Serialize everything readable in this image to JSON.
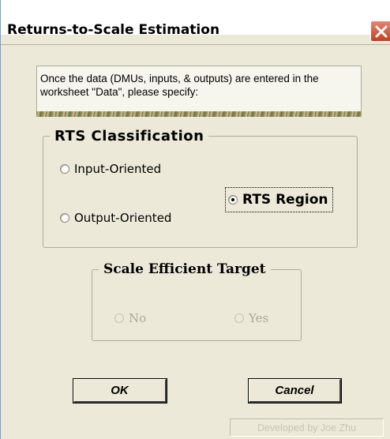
{
  "window": {
    "title": "Returns-to-Scale Estimation",
    "close_icon": "close-x-icon"
  },
  "info": {
    "text": "Once the data (DMUs, inputs, & outputs) are entered in the worksheet \"Data\", please specify:"
  },
  "rts_classification": {
    "title": "RTS Classification",
    "options": [
      {
        "label": "Input-Oriented",
        "selected": false
      },
      {
        "label": "Output-Oriented",
        "selected": false
      },
      {
        "label": "RTS Region",
        "selected": true
      }
    ]
  },
  "scale_efficient_target": {
    "title": "Scale Efficient Target",
    "enabled": false,
    "options": [
      {
        "label": "No",
        "selected": false
      },
      {
        "label": "Yes",
        "selected": false
      }
    ]
  },
  "buttons": {
    "ok": "OK",
    "cancel": "Cancel"
  },
  "footer": {
    "credit": "Developed by Joe Zhu"
  },
  "colors": {
    "dialog_bg": "#ece9d8",
    "close_button": "#d85f3c",
    "disabled_text": "#aca899"
  }
}
